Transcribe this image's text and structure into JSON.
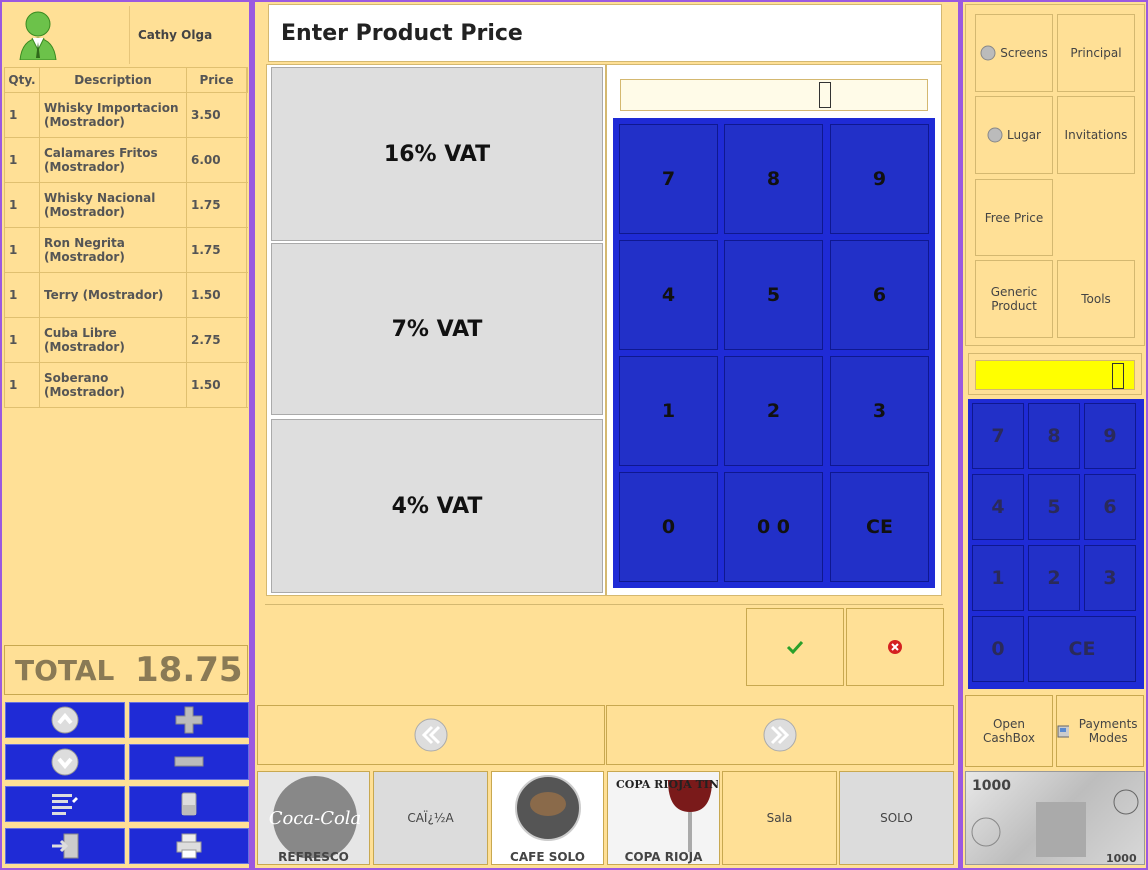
{
  "user": {
    "name": "Cathy Olga"
  },
  "ticket": {
    "headers": [
      "Qty.",
      "Description",
      "Price"
    ],
    "rows": [
      {
        "qty": "1",
        "desc": "Whisky Importacion (Mostrador)",
        "price": "3.50"
      },
      {
        "qty": "1",
        "desc": "Calamares Fritos (Mostrador)",
        "price": "6.00"
      },
      {
        "qty": "1",
        "desc": "Whisky Nacional (Mostrador)",
        "price": "1.75"
      },
      {
        "qty": "1",
        "desc": "Ron Negrita (Mostrador)",
        "price": "1.75"
      },
      {
        "qty": "1",
        "desc": "Terry (Mostrador)",
        "price": "1.50"
      },
      {
        "qty": "1",
        "desc": "Cuba Libre (Mostrador)",
        "price": "2.75"
      },
      {
        "qty": "1",
        "desc": "Soberano (Mostrador)",
        "price": "1.50"
      }
    ],
    "total_label": "TOTAL",
    "total_value": "18.75"
  },
  "dialog": {
    "title": "Enter Product Price",
    "vat_options": [
      "16% VAT",
      "7% VAT",
      "4% VAT"
    ],
    "keys": [
      "7",
      "8",
      "9",
      "4",
      "5",
      "6",
      "1",
      "2",
      "3",
      "0",
      "0 0",
      "CE"
    ]
  },
  "products": [
    {
      "label": "REFRESCO",
      "logo_text": "Coca-Cola"
    },
    {
      "label": "CAÏ¿½A"
    },
    {
      "label": "CAFE SOLO"
    },
    {
      "label": "COPA RIOJA",
      "logo_text": "COPA RIOJA TINTO"
    },
    {
      "label": "Sala"
    },
    {
      "label": "SOLO"
    }
  ],
  "menu": {
    "screens": "Screens",
    "principal": "Principal",
    "lugar": "Lugar",
    "invitations": "Invitations",
    "free_price": "Free Price",
    "generic_product": "Generic Product",
    "tools": "Tools"
  },
  "right_keys": [
    "7",
    "8",
    "9",
    "4",
    "5",
    "6",
    "1",
    "2",
    "3",
    "0",
    "CE"
  ],
  "bottom": {
    "open_cashbox": "Open CashBox",
    "payment_modes": "Payments Modes"
  },
  "colors": {
    "panel": "#ffe096",
    "keypad": "#1f2bd6",
    "display": "#ffff00"
  }
}
